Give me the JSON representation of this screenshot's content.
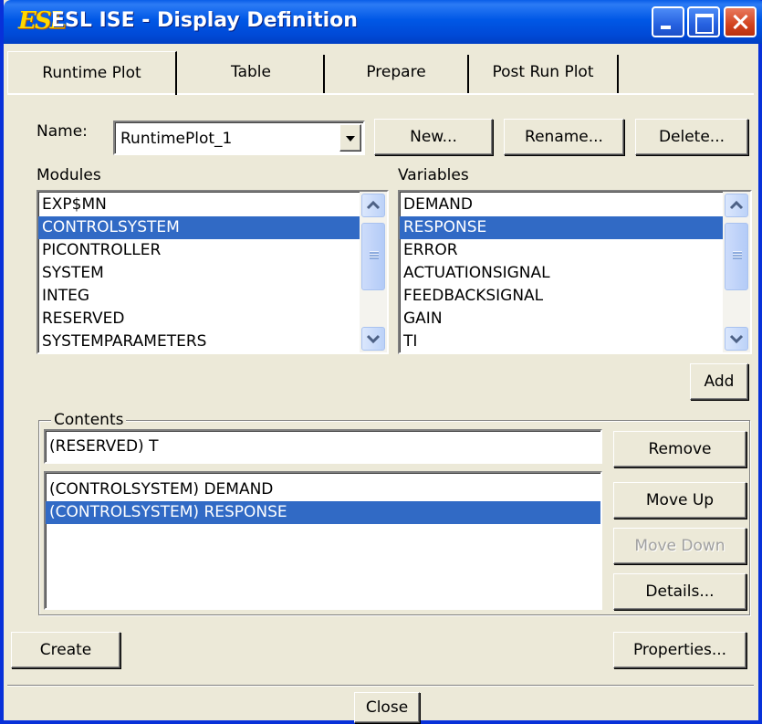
{
  "window": {
    "title": "ESL ISE - Display Definition",
    "app_icon_text": "ESL"
  },
  "tabs": [
    {
      "label": "Runtime Plot",
      "active": true
    },
    {
      "label": "Table",
      "active": false
    },
    {
      "label": "Prepare",
      "active": false
    },
    {
      "label": "Post Run Plot",
      "active": false
    }
  ],
  "name_row": {
    "label": "Name:",
    "value": "RuntimePlot_1",
    "new_label": "New...",
    "rename_label": "Rename...",
    "delete_label": "Delete..."
  },
  "modules": {
    "label": "Modules",
    "items": [
      "EXP$MN",
      "CONTROLSYSTEM",
      "PICONTROLLER",
      "SYSTEM",
      "INTEG",
      "RESERVED",
      "SYSTEMPARAMETERS"
    ],
    "selected_index": 1
  },
  "variables": {
    "label": "Variables",
    "items": [
      "DEMAND",
      "RESPONSE",
      "ERROR",
      "ACTUATIONSIGNAL",
      "FEEDBACKSIGNAL",
      "GAIN",
      "TI"
    ],
    "selected_index": 1
  },
  "add_label": "Add",
  "contents": {
    "title": "Contents",
    "entry_value": "(RESERVED) T",
    "items": [
      "(CONTROLSYSTEM) DEMAND",
      "(CONTROLSYSTEM) RESPONSE"
    ],
    "selected_index": 1,
    "remove_label": "Remove",
    "move_up_label": "Move Up",
    "move_down_label": "Move Down",
    "move_down_enabled": false,
    "details_label": "Details..."
  },
  "create_label": "Create",
  "properties_label": "Properties...",
  "close_label": "Close",
  "colors": {
    "titlebar": "#0058e6",
    "selection": "#316ac5",
    "face": "#ece9d8"
  }
}
